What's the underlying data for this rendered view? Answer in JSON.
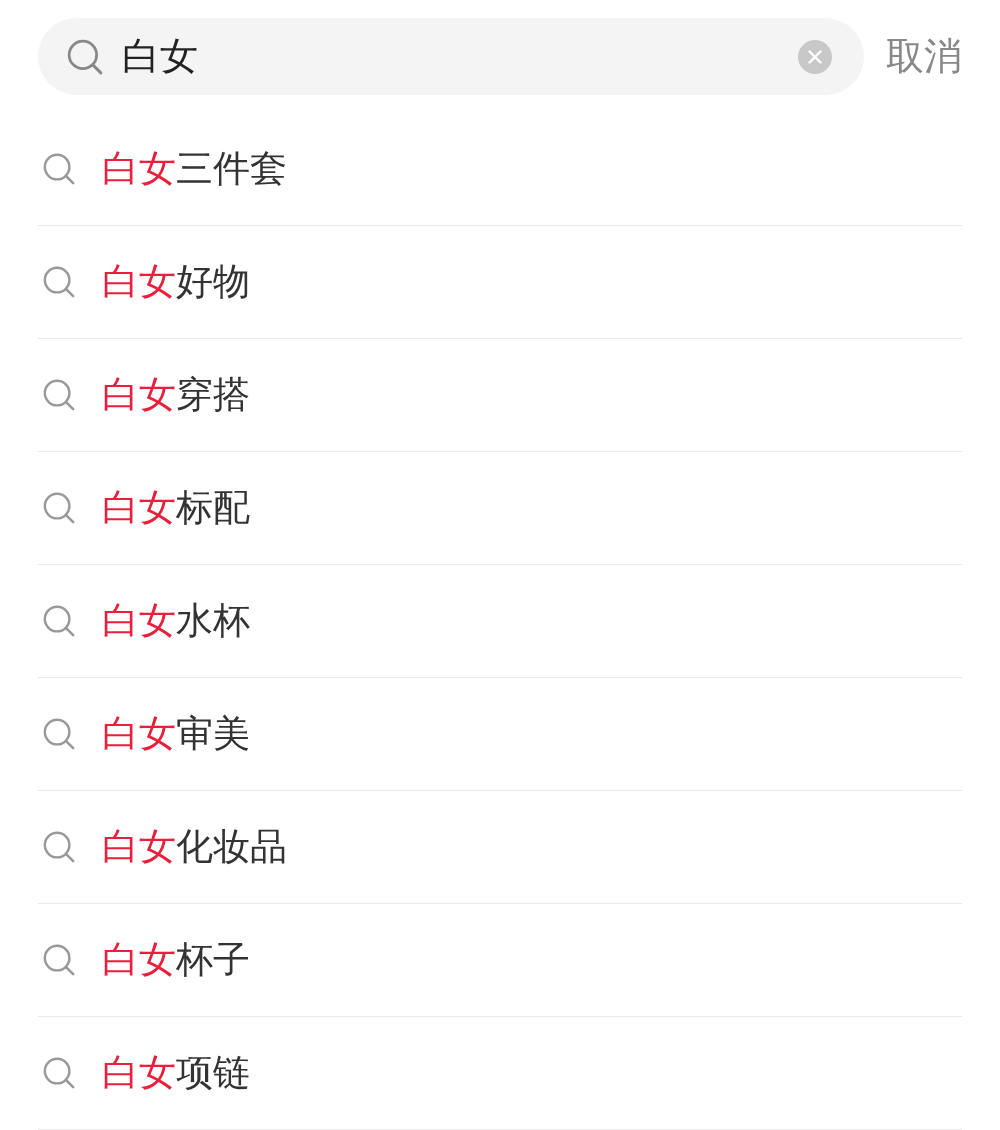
{
  "search": {
    "value": "白女",
    "cancel": "取消"
  },
  "suggestions": [
    {
      "match": "白女",
      "rest": "三件套"
    },
    {
      "match": "白女",
      "rest": "好物"
    },
    {
      "match": "白女",
      "rest": "穿搭"
    },
    {
      "match": "白女",
      "rest": "标配"
    },
    {
      "match": "白女",
      "rest": "水杯"
    },
    {
      "match": "白女",
      "rest": "审美"
    },
    {
      "match": "白女",
      "rest": "化妆品"
    },
    {
      "match": "白女",
      "rest": "杯子"
    },
    {
      "match": "白女",
      "rest": "项链"
    }
  ]
}
